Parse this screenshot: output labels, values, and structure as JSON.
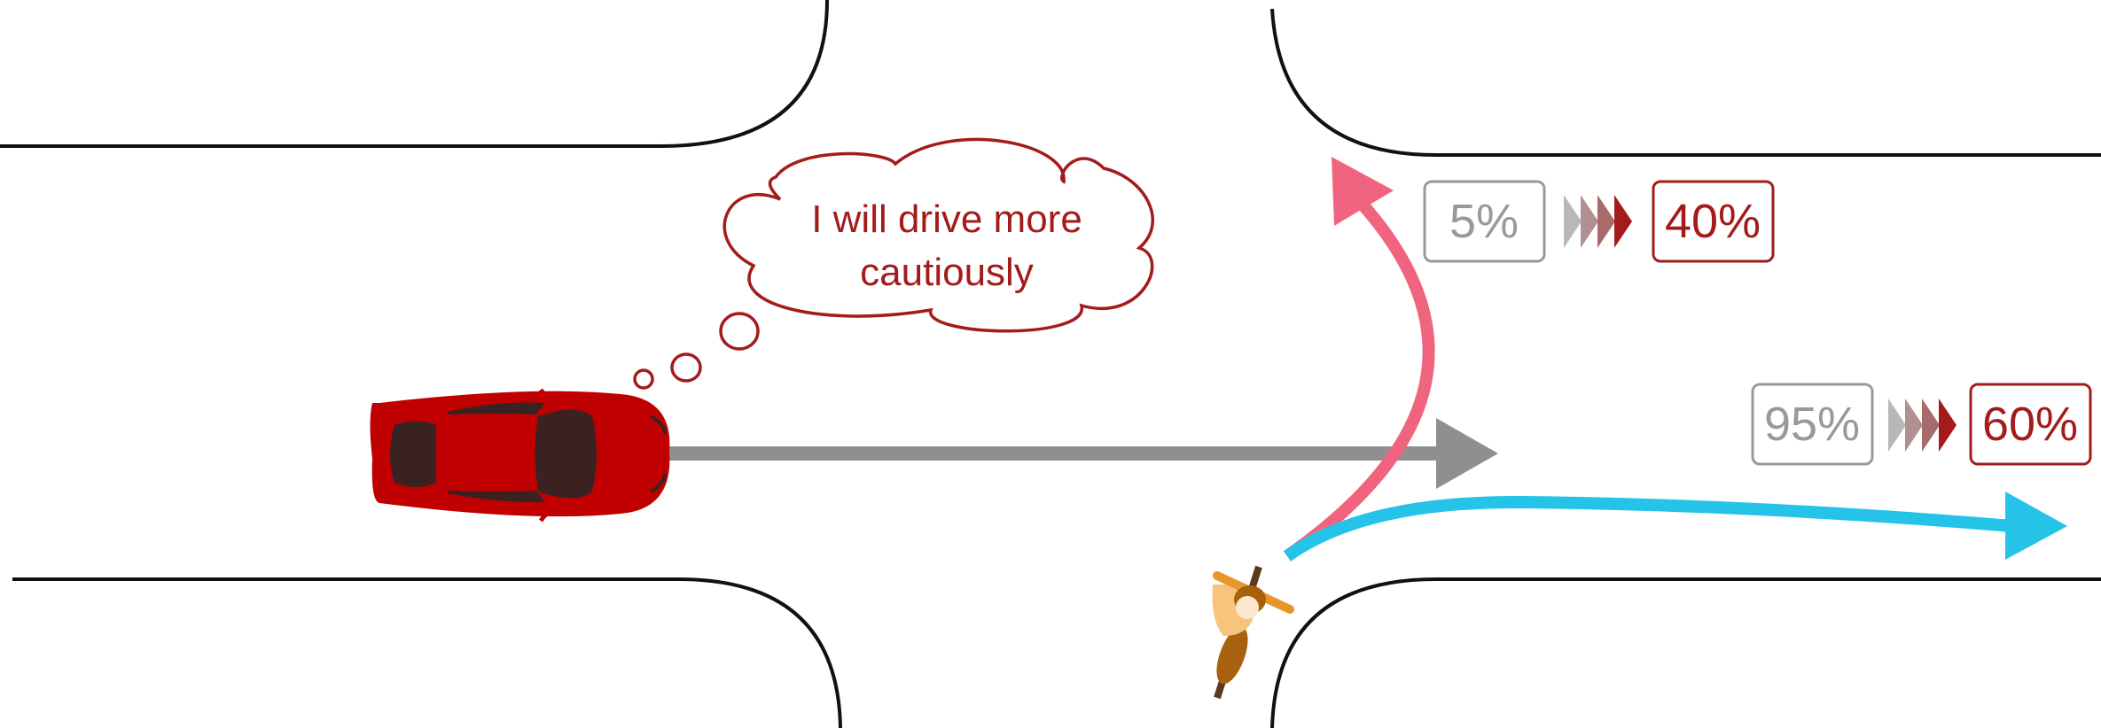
{
  "thought": {
    "line1": "I will drive more",
    "line2": "cautiously"
  },
  "predictions": {
    "turn_left": {
      "before": "5%",
      "after": "40%"
    },
    "go_straight": {
      "before": "95%",
      "after": "60%"
    }
  },
  "colors": {
    "car": "#c00000",
    "car_windows": "#3a2222",
    "thought": "#a31b1b",
    "before_box": "#999999",
    "after_box": "#a31b1b",
    "straight_arrow": "#8f8f8f",
    "left_turn_arrow": "#f06480",
    "right_path_arrow": "#25c3e8",
    "cyclist_skin": "#f7c47e",
    "cyclist_bike": "#a8610f"
  }
}
